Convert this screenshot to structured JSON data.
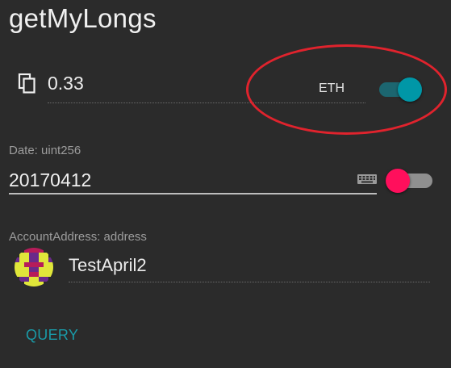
{
  "title": "getMyLongs",
  "amount": {
    "icon": "copy-icon",
    "value": "0.33",
    "unit_label": "ETH",
    "unit_toggle_on": true
  },
  "date_field": {
    "label": "Date: uint256",
    "value": "20170412",
    "keyboard_icon": "keyboard-icon",
    "toggle_on": false
  },
  "address_field": {
    "label": "AccountAddress: address",
    "account_name": "TestApril2",
    "avatar": "identicon-avatar"
  },
  "actions": {
    "query_label": "QUERY"
  },
  "colors": {
    "background": "#2b2b2b",
    "accent": "#0097a7",
    "toggle_off_thumb": "#ff0f5c",
    "highlight": "#e0232d"
  }
}
